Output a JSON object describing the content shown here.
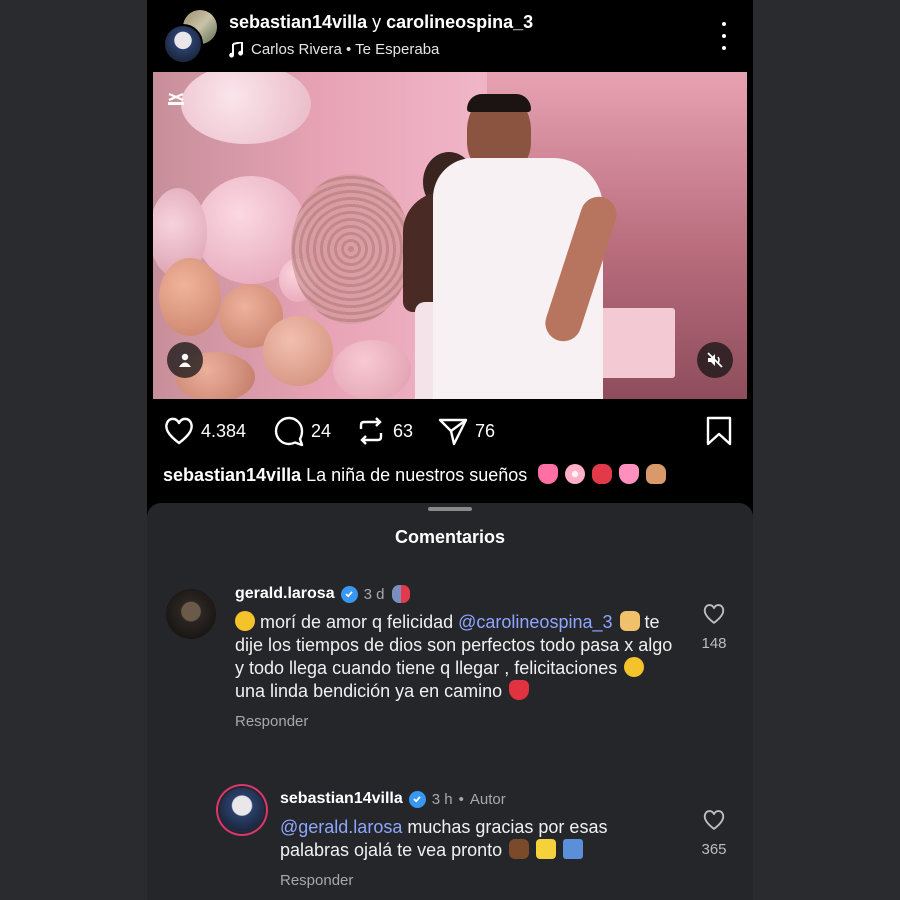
{
  "header": {
    "user1": "sebastian14villa",
    "conjunction": "y",
    "user2": "carolineospina_3",
    "music": "Carlos Rivera • Te Esperaba"
  },
  "actions": {
    "likes": "4.384",
    "comments": "24",
    "reposts": "63",
    "shares": "76"
  },
  "caption": {
    "user": "sebastian14villa",
    "text": "La niña de nuestros sueños"
  },
  "sheet": {
    "title": "Comentarios"
  },
  "comments": [
    {
      "user": "gerald.larosa",
      "time": "3 d",
      "mention": "@carolineospina_3",
      "text_before": "morí de amor q felicidad",
      "text_after": "te dije los tiempos de dios son perfectos todo pasa x algo y todo llega cuando tiene q llegar , felicitaciones",
      "text_end": "una linda bendición ya en camino",
      "reply": "Responder",
      "likes": "148"
    },
    {
      "user": "sebastian14villa",
      "time": "3 h",
      "author": "Autor",
      "mention": "@gerald.larosa",
      "text": "muchas gracias por esas palabras ojalá te vea pronto",
      "reply": "Responder",
      "likes": "365"
    }
  ],
  "icons": {
    "music": "music-note-icon",
    "more": "more-vertical-icon",
    "like": "heart-icon",
    "comment": "comment-icon",
    "repost": "repost-icon",
    "share": "send-icon",
    "save": "bookmark-icon",
    "tags": "user-tag-icon",
    "mute": "muted-speaker-icon"
  },
  "colors": {
    "background": "#2a2b2e",
    "sheet": "#25262a",
    "mention": "#8fa6ff",
    "verified": "#3897f0"
  }
}
